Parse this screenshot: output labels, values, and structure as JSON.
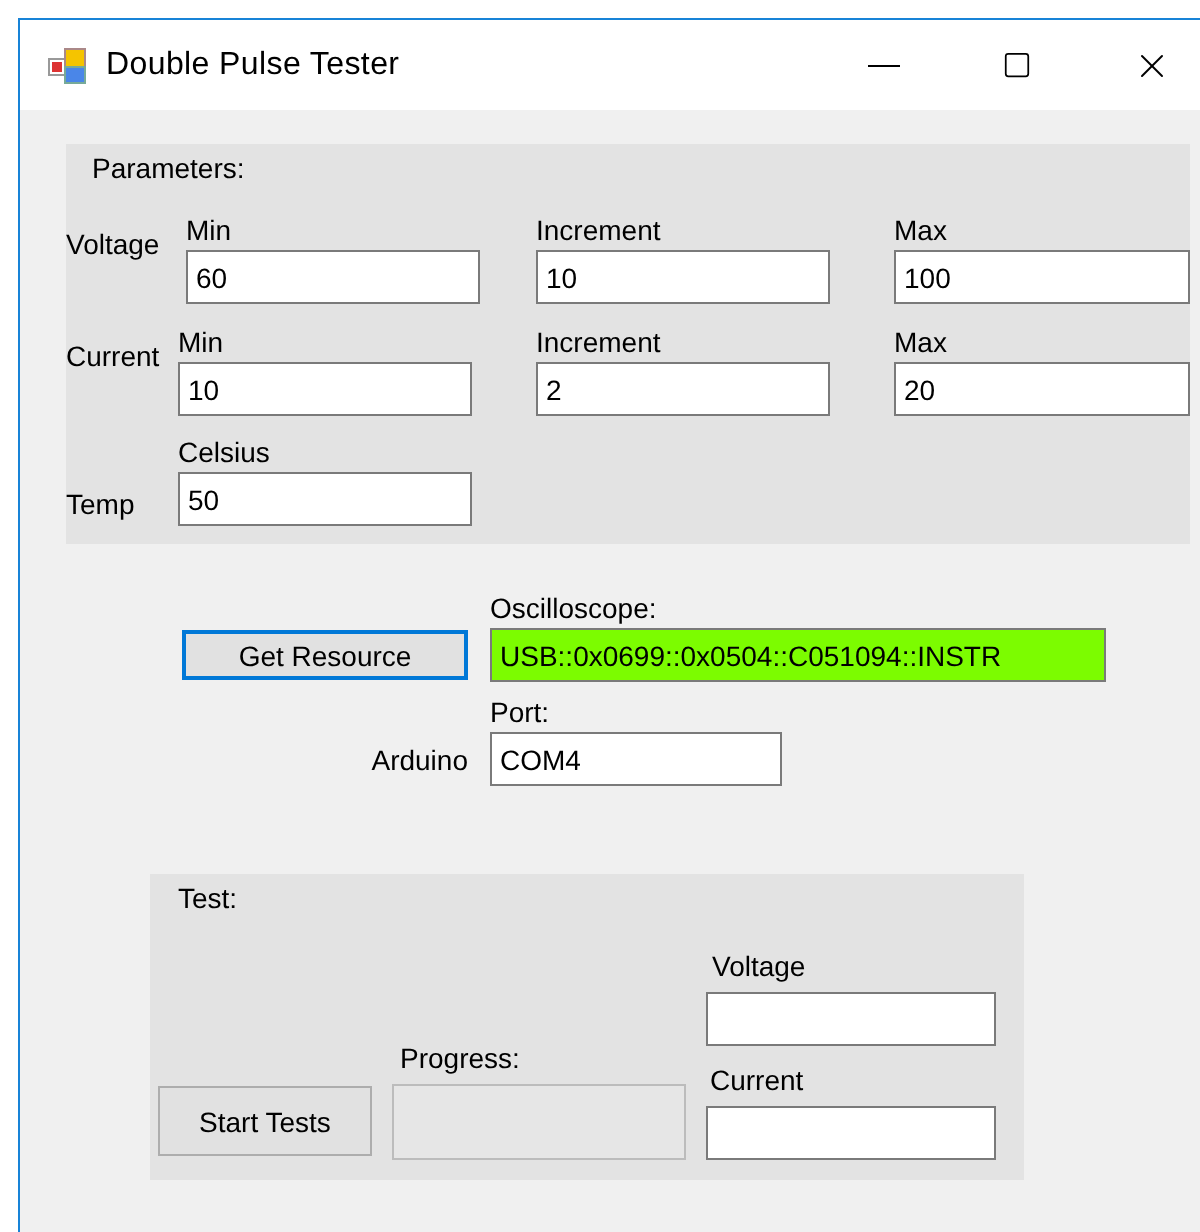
{
  "window": {
    "title": "Double Pulse Tester"
  },
  "parameters": {
    "title": "Parameters:",
    "rows": [
      {
        "label": "Voltage",
        "fields": [
          {
            "label": "Min",
            "value": "60"
          },
          {
            "label": "Increment",
            "value": "10"
          },
          {
            "label": "Max",
            "value": "100"
          }
        ]
      },
      {
        "label": "Current",
        "fields": [
          {
            "label": "Min",
            "value": "10"
          },
          {
            "label": "Increment",
            "value": "2"
          },
          {
            "label": "Max",
            "value": "20"
          }
        ]
      },
      {
        "label": "Temp",
        "fields": [
          {
            "label": "Celsius",
            "value": "50"
          }
        ]
      }
    ]
  },
  "resource": {
    "button": "Get Resource",
    "oscilloscope": {
      "label": "Oscilloscope:",
      "value": "USB::0x0699::0x0504::C051094::INSTR",
      "color": "#7cfc00"
    },
    "arduino": {
      "label": "Arduino",
      "port_label": "Port:",
      "value": "COM4"
    }
  },
  "test": {
    "title": "Test:",
    "button": "Start Tests",
    "progress": {
      "label": "Progress:",
      "level": 0
    },
    "voltage": {
      "label": "Voltage"
    },
    "current": {
      "label": "Current"
    }
  }
}
